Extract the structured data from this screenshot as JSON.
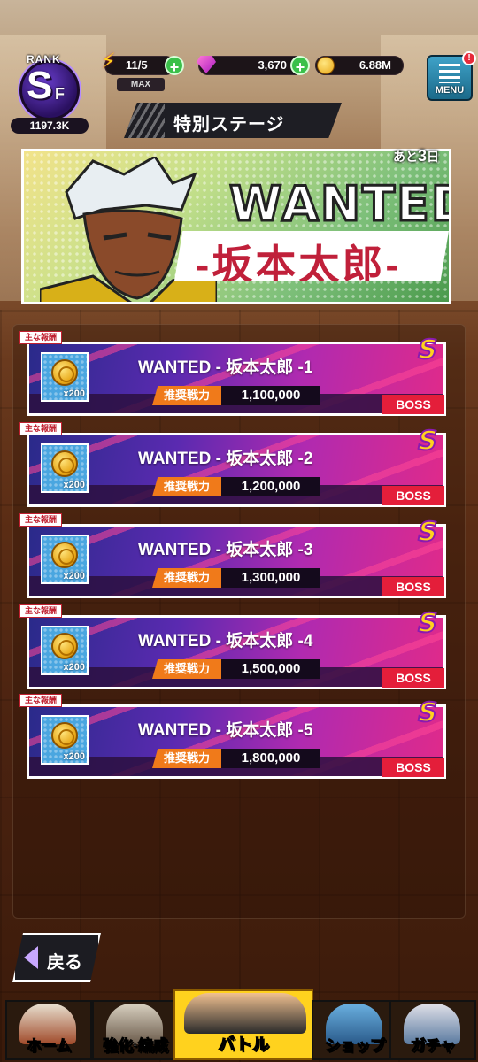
{
  "status_bar": {
    "rank_label": "RANK",
    "rank_letter": "S",
    "rank_sub": "F",
    "rank_value": "1197.3K",
    "stamina": "11/5",
    "stamina_max": "MAX",
    "gems": "3,670",
    "coins": "6.88M",
    "menu_label": "MENU",
    "menu_badge": "!"
  },
  "header": {
    "title": "特別ステージ"
  },
  "banner": {
    "headline": "WANTED",
    "name": "-坂本太郎-",
    "days_prefix": "あと",
    "days_count": "3",
    "days_suffix": "日"
  },
  "stages": [
    {
      "reward_tag": "主な報酬",
      "title": "WANTED - 坂本太郎 -1",
      "power_label": "推奨戦力",
      "power": "1,100,000",
      "boss": "BOSS",
      "rank": "S",
      "reward_qty": "x200"
    },
    {
      "reward_tag": "主な報酬",
      "title": "WANTED - 坂本太郎 -2",
      "power_label": "推奨戦力",
      "power": "1,200,000",
      "boss": "BOSS",
      "rank": "S",
      "reward_qty": "x200"
    },
    {
      "reward_tag": "主な報酬",
      "title": "WANTED - 坂本太郎 -3",
      "power_label": "推奨戦力",
      "power": "1,300,000",
      "boss": "BOSS",
      "rank": "S",
      "reward_qty": "x200"
    },
    {
      "reward_tag": "主な報酬",
      "title": "WANTED - 坂本太郎 -4",
      "power_label": "推奨戦力",
      "power": "1,500,000",
      "boss": "BOSS",
      "rank": "S",
      "reward_qty": "x200"
    },
    {
      "reward_tag": "主な報酬",
      "title": "WANTED - 坂本太郎 -5",
      "power_label": "推奨戦力",
      "power": "1,800,000",
      "boss": "BOSS",
      "rank": "S",
      "reward_qty": "x200"
    }
  ],
  "back_button": {
    "label": "戻る"
  },
  "nav": {
    "home": "ホーム",
    "enhance": "強化·編成",
    "battle": "バトル",
    "shop": "ショップ",
    "gacha": "ガチャ"
  },
  "colors": {
    "accent_pink": "#e02a8a",
    "boss_red": "#e41e3a",
    "power_orange": "#f07a1a",
    "rank_purple": "#6b3fd0"
  }
}
